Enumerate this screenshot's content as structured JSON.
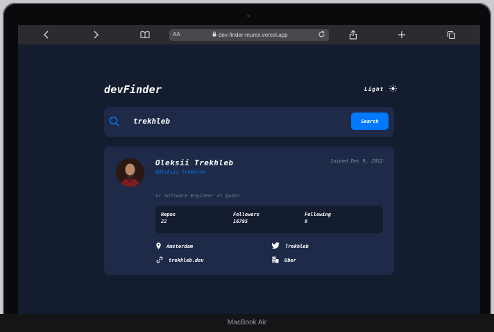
{
  "device": {
    "label": "MacBook Air"
  },
  "browser": {
    "text_size_label": "AA",
    "url": "dev-finder-murex.vercel.app",
    "icons": [
      "back-icon",
      "forward-icon",
      "reader-icon",
      "lock-icon",
      "reload-icon",
      "share-icon",
      "new-tab-icon",
      "tabs-icon"
    ]
  },
  "app": {
    "brand": "devFinder",
    "theme_label": "Light",
    "search": {
      "value": "trekhleb",
      "button_label": "Search"
    },
    "profile": {
      "name": "Oleksii Trekhleb",
      "handle": "@Oleksii Trekhleb",
      "joined": "Joined Dec 9, 2012",
      "bio": "Sr Software Engineer at @uber",
      "stats": [
        {
          "label": "Repos",
          "value": "22"
        },
        {
          "label": "Followers",
          "value": "16795"
        },
        {
          "label": "Following",
          "value": "8"
        }
      ],
      "links": {
        "location": "Amsterdam",
        "twitter": "Trekhleb",
        "website": "trekhleb.dev",
        "company": "Uber"
      }
    }
  },
  "colors": {
    "background": "#141d2f",
    "card": "#1e2a47",
    "accent": "#0079ff",
    "text": "#ffffff"
  }
}
